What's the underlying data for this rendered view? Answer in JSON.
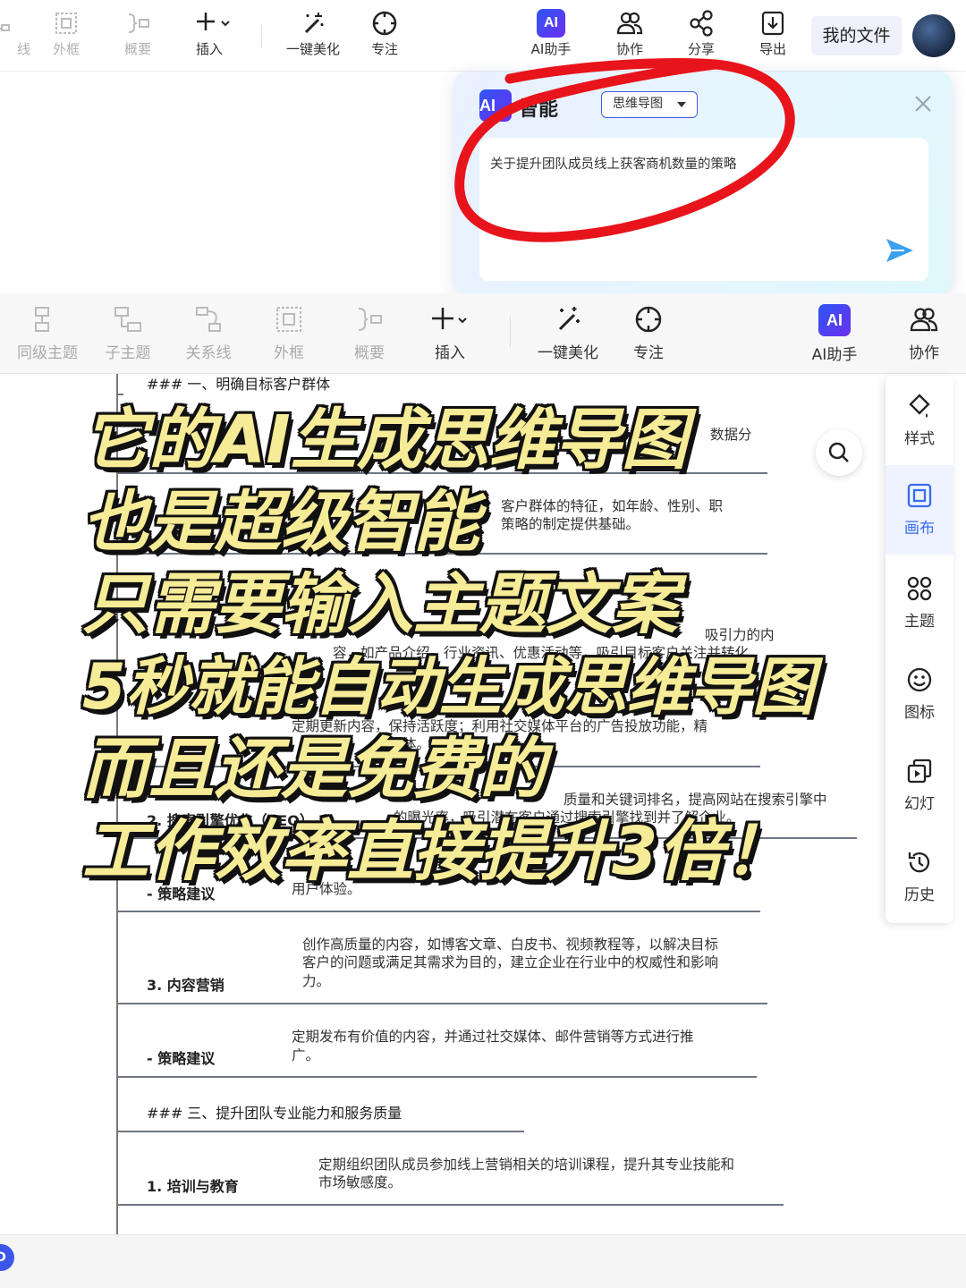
{
  "top_toolbar": {
    "items": [
      {
        "label": "线",
        "icon": "line-icon"
      },
      {
        "label": "外框",
        "icon": "frame-icon"
      },
      {
        "label": "概要",
        "icon": "summary-icon"
      },
      {
        "label": "插入",
        "icon": "plus-icon"
      },
      {
        "label": "一键美化",
        "icon": "magic-wand-icon"
      },
      {
        "label": "专注",
        "icon": "focus-icon"
      },
      {
        "label": "AI助手",
        "icon": "ai-icon"
      },
      {
        "label": "协作",
        "icon": "people-icon"
      },
      {
        "label": "分享",
        "icon": "share-icon"
      },
      {
        "label": "导出",
        "icon": "export-icon"
      }
    ],
    "ai_badge": "AI",
    "my_files": "我的文件"
  },
  "ai_panel": {
    "badge": "AI",
    "title": "智能",
    "mode": "思维导图",
    "prompt": "关于提升团队成员线上获客商机数量的策略"
  },
  "toolbar2": {
    "items": [
      {
        "label": "同级主题",
        "icon": "sibling-topic-icon"
      },
      {
        "label": "子主题",
        "icon": "child-topic-icon"
      },
      {
        "label": "关系线",
        "icon": "relation-line-icon"
      },
      {
        "label": "外框",
        "icon": "frame-icon"
      },
      {
        "label": "概要",
        "icon": "summary-icon"
      },
      {
        "label": "插入",
        "icon": "plus-icon"
      },
      {
        "label": "一键美化",
        "icon": "magic-wand-icon"
      },
      {
        "label": "专注",
        "icon": "focus-icon"
      },
      {
        "label": "AI助手",
        "icon": "ai-icon"
      },
      {
        "label": "协作",
        "icon": "people-icon"
      }
    ],
    "ai_badge": "AI"
  },
  "side_panel": {
    "items": [
      {
        "label": "样式",
        "icon": "style-icon"
      },
      {
        "label": "画布",
        "icon": "canvas-icon"
      },
      {
        "label": "主题",
        "icon": "theme-icon"
      },
      {
        "label": "图标",
        "icon": "emoji-icon"
      },
      {
        "label": "幻灯",
        "icon": "slides-icon"
      },
      {
        "label": "历史",
        "icon": "history-icon"
      }
    ],
    "active": "画布"
  },
  "document": {
    "section1_heading": "### 一、明确目标客户群体",
    "frag_data": "数据分",
    "frag_customer": "客户群体的特征，如年龄、性别、职",
    "frag_strategy": "策略的制定提供基础。",
    "frag_attract": "吸引力的内",
    "frag_content": "容，如产品介绍、行业资讯、优惠活动等，吸引目标客户关注并转化",
    "frag_update": "定期更新内容，保持活跃度；利用社交媒体平台的广告投放功能，精",
    "frag_body": "体。",
    "frag_seo": "质量和关键词排名，提高网站在搜索引擎中",
    "frag_exposure": "的曝光率，吸引潜在客户通过搜索引擎找到并了解企业。",
    "seo_label": "2. 搜索引擎优化（SEO）",
    "strategy_label": "- 策略建议",
    "frag_ux": "用户体验。",
    "content_label": "3. 内容营销",
    "content_text": [
      "创作高质量的内容，如博客文章、白皮书、视频教程等，以解决目标",
      "客户的问题或满足其需求为目的，建立企业在行业中的权威性和影响",
      "力。"
    ],
    "strategy2_label": "- 策略建议",
    "strategy2_text": [
      "定期发布有价值的内容，并通过社交媒体、邮件营销等方式进行推",
      "广。"
    ],
    "section3_heading": "### 三、提升团队专业能力和服务质量",
    "training_label": "1. 培训与教育",
    "training_text": [
      "定期组织团队成员参加线上营销相关的培训课程，提升其专业技能和",
      "市场敏感度。"
    ]
  },
  "caption": {
    "lines": [
      "它的AI生成思维导图",
      "也是超级智能",
      "只需要输入主题文案",
      "5秒就能自动生成思维导图",
      "而且还是免费的",
      "工作效率直接提升3倍！"
    ]
  },
  "bottom": {
    "logo": "D"
  }
}
